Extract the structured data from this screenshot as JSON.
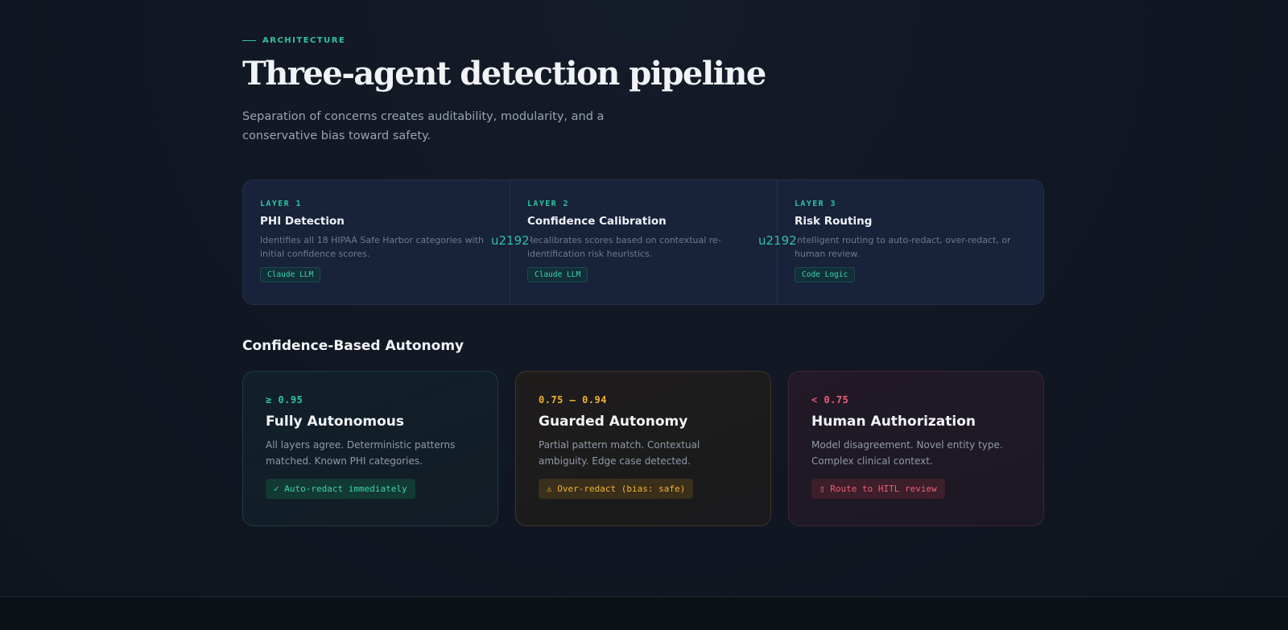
{
  "header": {
    "eyebrow": "ARCHITECTURE",
    "title": "Three-agent detection pipeline",
    "subtitle": "Separation of concerns creates auditability, modularity, and a conservative bias toward safety."
  },
  "pipeline": {
    "arrow_glyph": "u2192",
    "layers": [
      {
        "tag": "LAYER 1",
        "name": "PHI Detection",
        "desc": "Identifies all 18 HIPAA Safe Harbor categories with initial confidence scores.",
        "chip": "Claude LLM"
      },
      {
        "tag": "LAYER 2",
        "name": "Confidence Calibration",
        "desc": "Recalibrates scores based on contextual re-identification risk heuristics.",
        "chip": "Claude LLM"
      },
      {
        "tag": "LAYER 3",
        "name": "Risk Routing",
        "desc": "Intelligent routing to auto-redact, over-redact, or human review.",
        "chip": "Code Logic"
      }
    ]
  },
  "autonomy": {
    "section_title": "Confidence-Based Autonomy",
    "cards": [
      {
        "range": "≥ 0.95",
        "title": "Fully Autonomous",
        "desc": "All layers agree. Deterministic patterns matched. Known PHI categories.",
        "action": "✓ Auto-redact immediately",
        "color": "#2fc49a"
      },
      {
        "range": "0.75 – 0.94",
        "title": "Guarded Autonomy",
        "desc": "Partial pattern match. Contextual ambiguity. Edge case detected.",
        "action": "⚠ Over-redact (bias: safe)",
        "color": "#f2b233"
      },
      {
        "range": "< 0.75",
        "title": "Human Authorization",
        "desc": "Model disagreement. Novel entity type. Complex clinical context.",
        "action": "▯ Route to HITL review",
        "color": "#ef5d79"
      }
    ]
  }
}
